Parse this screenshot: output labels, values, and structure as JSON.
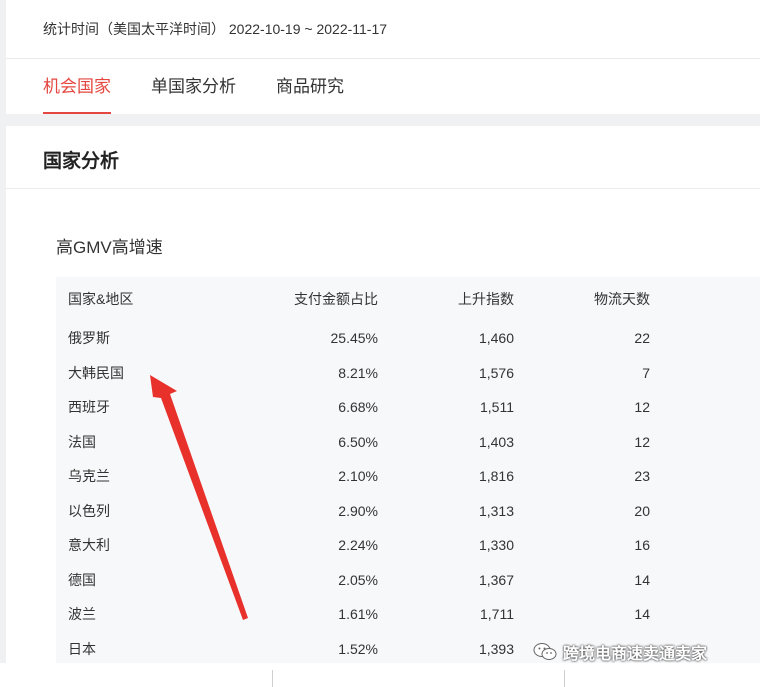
{
  "header": {
    "stat_time": "统计时间（美国太平洋时间）  2022-10-19 ~ 2022-11-17"
  },
  "tabs": [
    {
      "label": "机会国家",
      "active": true
    },
    {
      "label": "单国家分析",
      "active": false
    },
    {
      "label": "商品研究",
      "active": false
    }
  ],
  "section": {
    "title": "国家分析",
    "subtitle": "高GMV高增速"
  },
  "table": {
    "columns": [
      "国家&地区",
      "支付金额占比",
      "上升指数",
      "物流天数"
    ],
    "rows": [
      [
        "俄罗斯",
        "25.45%",
        "1,460",
        "22"
      ],
      [
        "大韩民国",
        "8.21%",
        "1,576",
        "7"
      ],
      [
        "西班牙",
        "6.68%",
        "1,511",
        "12"
      ],
      [
        "法国",
        "6.50%",
        "1,403",
        "12"
      ],
      [
        "乌克兰",
        "2.10%",
        "1,816",
        "23"
      ],
      [
        "以色列",
        "2.90%",
        "1,313",
        "20"
      ],
      [
        "意大利",
        "2.24%",
        "1,330",
        "16"
      ],
      [
        "德国",
        "2.05%",
        "1,367",
        "14"
      ],
      [
        "波兰",
        "1.61%",
        "1,711",
        "14"
      ],
      [
        "日本",
        "1.52%",
        "1,393",
        ""
      ]
    ]
  },
  "watermark": {
    "text": "跨境电商速卖通卖家",
    "icon": "wechat-icon"
  },
  "colors": {
    "accent": "#e4473f",
    "arrow": "#e8312b",
    "table_bg": "#f7f8fa",
    "page_bg": "#f0f1f3"
  }
}
